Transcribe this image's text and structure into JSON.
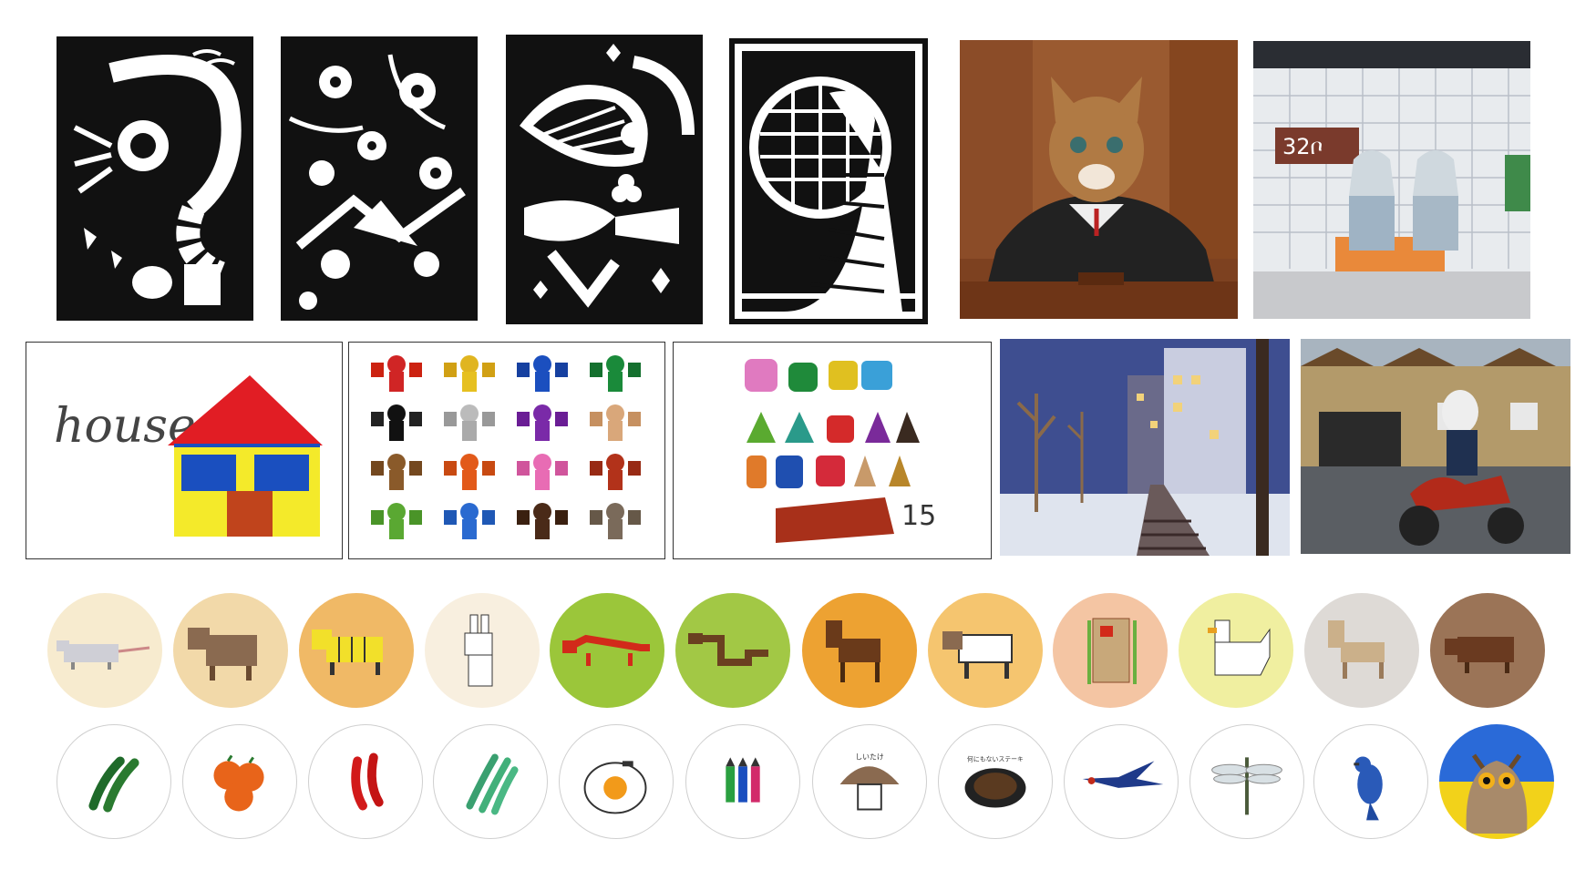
{
  "drawings": {
    "house_word": "house",
    "count_number": "15",
    "platform_sign": "32ቦ"
  },
  "stickers": {
    "mushroom_caption": "しいたけ",
    "steak_caption": "何にもないステーキ"
  },
  "zodiac_colors": [
    "#f7ebcf",
    "#f2d9a9",
    "#f0b966",
    "#f8efdf",
    "#9bc63a",
    "#a2c845",
    "#eda232",
    "#f5c56f",
    "#f4c5a3",
    "#f0efa0",
    "#dedad6",
    "#9b7457"
  ]
}
